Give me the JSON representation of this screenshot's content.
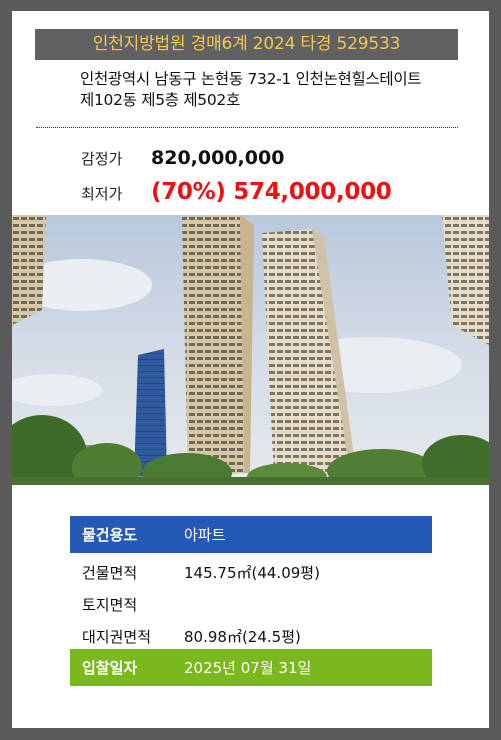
{
  "header": {
    "court": "인천지방법원 경매6계 2024 타경 529533"
  },
  "address": {
    "line1": "인천광역시 남동구 논현동 732-1 인천논현힐스테이트",
    "line2": "제102동 제5층 제502호"
  },
  "prices": {
    "appraisal_label": "감정가",
    "appraisal_value": "820,000,000",
    "minimum_label": "최저가",
    "minimum_value": "(70%) 574,000,000"
  },
  "details": {
    "usage_label": "물건용도",
    "usage_value": "아파트",
    "building_area_label": "건물면적",
    "building_area_value": "145.75㎡(44.09평)",
    "land_area_label": "토지면적",
    "land_area_value": "",
    "land_right_label": "대지권면적",
    "land_right_value": "80.98㎡(24.5평)",
    "bid_date_label": "입찰일자",
    "bid_date_value": "2025년 07월 31일"
  },
  "colors": {
    "banner_bg": "#5f6163",
    "banner_text": "#f2c94c",
    "minimum_price": "#ee1111",
    "usage_bg": "#2559b8",
    "bid_bg": "#7ab81e"
  }
}
